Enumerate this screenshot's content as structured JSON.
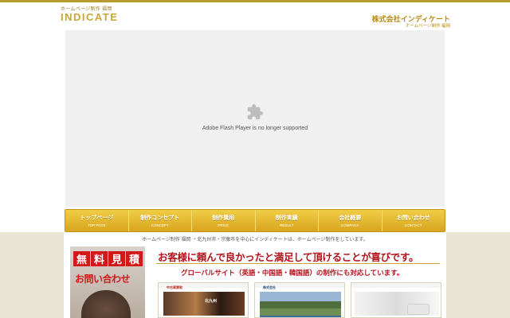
{
  "header": {
    "tagline": "ホームページ制作 福岡",
    "logo": "INDICATE",
    "company": "株式会社インディケート",
    "company_sub": "ホームページ制作 福岡"
  },
  "flash": {
    "message": "Adobe Flash Player is no longer supported",
    "icon": "puzzle-plugin-icon"
  },
  "nav": {
    "items": [
      {
        "jp": "トップページ",
        "en": "TOP PAGE"
      },
      {
        "jp": "制作コンセプト",
        "en": "CONCEPT"
      },
      {
        "jp": "制作費用",
        "en": "PRICE"
      },
      {
        "jp": "制作実績",
        "en": "RESULT"
      },
      {
        "jp": "会社概要",
        "en": "COMPANY"
      },
      {
        "jp": "お問い合わせ",
        "en": "CONTACT"
      }
    ]
  },
  "content": {
    "tagline": "ホームページ制作 福岡 ・北九州市・宗像市を中心にインディケートは、ホームページ制作をしています。",
    "banner": {
      "line1": [
        "無",
        "料",
        "見",
        "積"
      ],
      "line2": "お問い合わせ"
    },
    "headline": "お客様に頼んで良かったと満足して頂けることが喜びです。",
    "subheadline": "グローバルサイト（英語・中国語・韓国語）の制作にも対応しています。",
    "thumbnails": [
      {
        "title": "中古車買取",
        "caption": "北九州"
      },
      {
        "title": "株式会社",
        "caption": ""
      },
      {
        "title": "",
        "caption": ""
      }
    ]
  },
  "colors": {
    "accent_gold": "#c9a63a",
    "nav_gold": "#e0b02a",
    "headline_red": "#b5121b",
    "flash_bg": "#f0f0f0",
    "lower_bg": "#e9e5d3"
  }
}
